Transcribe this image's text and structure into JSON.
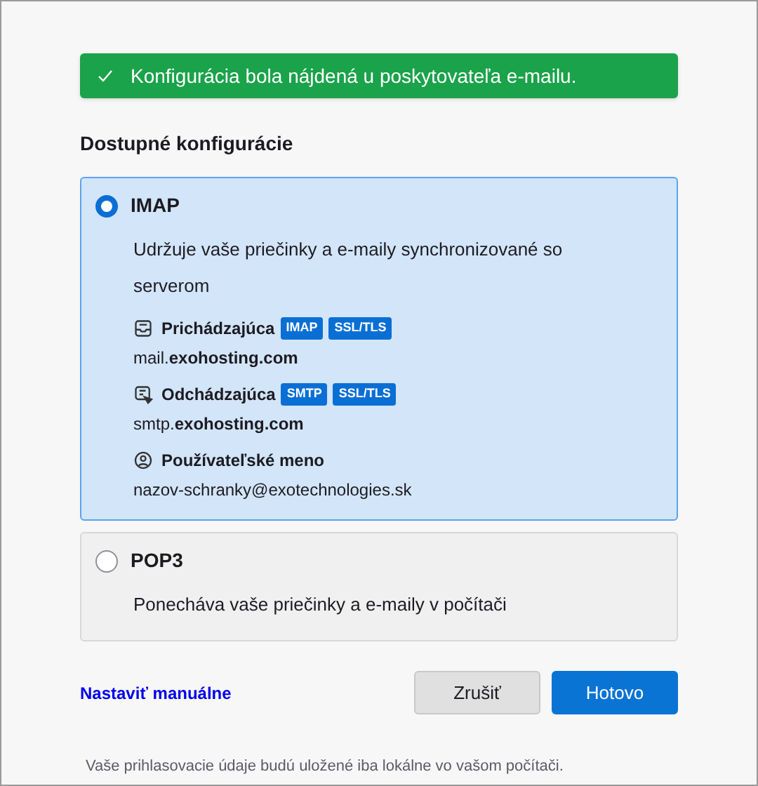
{
  "banner": {
    "text": "Konfigurácia bola nájdená u poskytovateľa e-mailu."
  },
  "heading": "Dostupné konfigurácie",
  "options": [
    {
      "label": "IMAP",
      "selected": true,
      "description": "Udržuje vaše priečinky a e-maily synchronizované so serverom",
      "details": [
        {
          "kind": "incoming",
          "label": "Prichádzajúca",
          "badges": [
            "IMAP",
            "SSL/TLS"
          ],
          "value": "mail.**exohosting.com**"
        },
        {
          "kind": "outgoing",
          "label": "Odchádzajúca",
          "badges": [
            "SMTP",
            "SSL/TLS"
          ],
          "value": "smtp.**exohosting.com**"
        },
        {
          "kind": "username",
          "label": "Používateľské meno",
          "value": "nazov-schranky@exotechnologies.sk"
        }
      ]
    },
    {
      "label": "POP3",
      "selected": false,
      "description": "Ponecháva vaše priečinky a e-maily v počítači"
    }
  ],
  "manual_link": "Nastaviť manuálne",
  "buttons": [
    {
      "label": "Zrušiť",
      "kind": "secondary"
    },
    {
      "label": "Hotovo",
      "kind": "primary"
    }
  ],
  "footer": "Vaše prihlasovacie údaje budú uložené iba lokálne vo vašom počítači."
}
